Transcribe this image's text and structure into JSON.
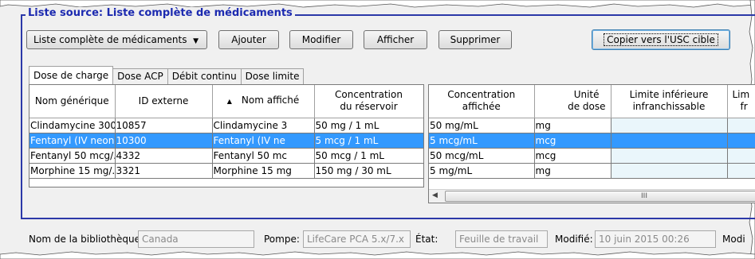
{
  "group_title": "Liste source: Liste complète de médicaments",
  "toolbar": {
    "dropdown_value": "Liste complète de médicaments",
    "add": "Ajouter",
    "modify": "Modifier",
    "view": "Afficher",
    "delete": "Supprimer",
    "copy": "Copier vers l'USC cible"
  },
  "tabs": [
    "Dose de charge",
    "Dose ACP",
    "Débit continu",
    "Dose limite"
  ],
  "left_grid": {
    "headers": [
      "Nom générique",
      "ID externe",
      "Nom affiché",
      "Concentration du réservoir"
    ],
    "header_lines": {
      "c4a": "Concentration",
      "c4b": "du réservoir"
    },
    "rows": [
      [
        "Clindamycine 300 ...",
        "10857",
        "Clindamycine 3",
        "50 mg / 1 mL"
      ],
      [
        "Fentanyl (IV neon...",
        "10300",
        "Fentanyl (IV ne",
        "5 mcg / 1 mL"
      ],
      [
        "Fentanyl 50 mcg/...",
        "4332",
        "Fentanyl 50 mc",
        "50 mcg / 1 mL"
      ],
      [
        "Morphine 15 mg/...",
        "3321",
        "Morphine 15 mg",
        "150 mg / 30 mL"
      ]
    ],
    "selected_row": 1
  },
  "right_grid": {
    "header_lines": {
      "c1a": "Concentration",
      "c1b": "affichée",
      "c2a": "Unité",
      "c2b": "de dose",
      "c3a": "Limite inférieure",
      "c3b": "infranchissable",
      "c4a": "Lim",
      "c4b": "fr"
    },
    "rows": [
      [
        "50 mg/mL",
        "mg"
      ],
      [
        "5 mcg/mL",
        "mcg"
      ],
      [
        "50 mcg/mL",
        "mcg"
      ],
      [
        "5 mg/mL",
        "mg"
      ]
    ],
    "scroll_grip": "III"
  },
  "status": {
    "library_label": "Nom de la bibliothèque:",
    "library_value": "Canada",
    "pump_label": "Pompe:",
    "pump_value": "LifeCare PCA 5.x/7.x",
    "state_label": "État:",
    "state_value": "Feuille de travail",
    "modified_label": "Modifié:",
    "modified_value": "10 juin 2015 00:26",
    "modified_by_label": "Modi"
  }
}
